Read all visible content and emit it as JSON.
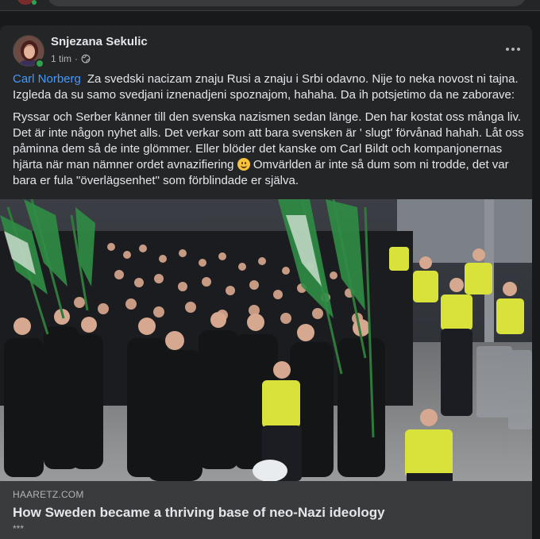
{
  "post": {
    "author": "Snjezana Sekulic",
    "time": "1 tim",
    "mention": "Carl Norberg",
    "paragraph1": "Za svedski nacizam znaju Rusi a znaju i Srbi odavno. Nije to neka novost ni tajna. Izgleda da su samo svedjani iznenadjeni spoznajom, hahaha.  Da ih potsjetimo da ne zaborave:",
    "paragraph2a": "Ryssar och Serber känner till den svenska nazismen sedan länge. Den har kostat oss många liv. Det är inte någon nyhet alls. Det verkar som att bara svensken är ' slugt' förvånad hahah. Låt oss påminna dem så de inte glömmer. Eller blöder det kanske om Carl Bildt och kompanjonernas hjärta när man nämner ordet avnazifiering",
    "paragraph2b": " Omvärlden är inte så dum som ni trodde, det var bara er fula \"överlägsenhet\" som förblindade er själva."
  },
  "link": {
    "domain": "HAARETZ.COM",
    "title": "How Sweden became a thriving base of neo-Nazi ideology",
    "description": "***"
  },
  "icons": {
    "privacy": "globe-icon",
    "menu": "more-options-icon",
    "emoji": "smiling-face-icon"
  },
  "colors": {
    "background": "#18191a",
    "card": "#242526",
    "link_footer": "#3a3b3c",
    "mention": "#4599ff",
    "online": "#31a24c"
  }
}
